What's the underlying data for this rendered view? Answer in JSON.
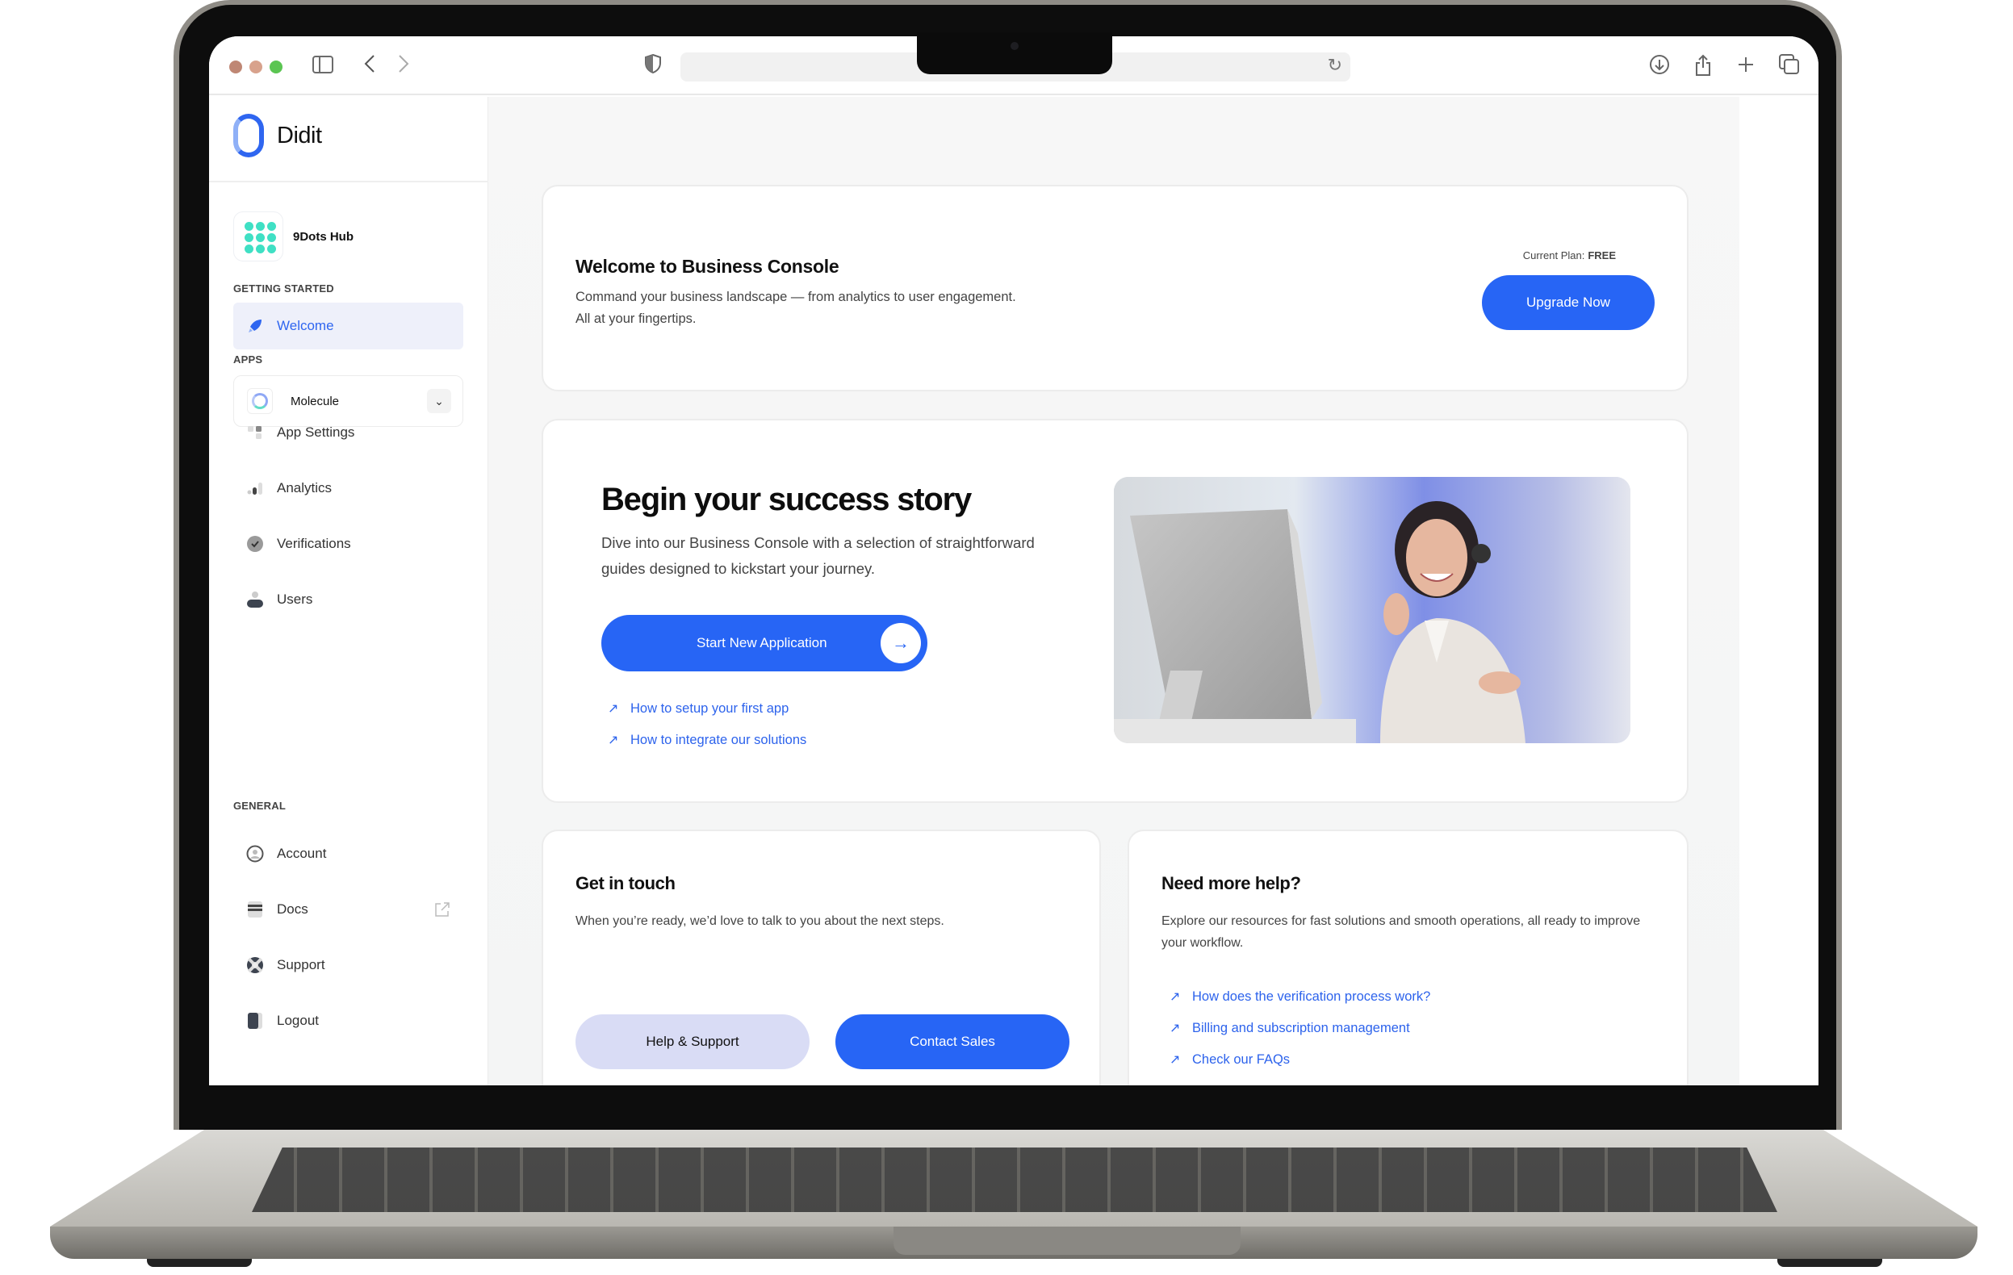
{
  "browser": {
    "traffic_lights": [
      "#bf8774",
      "#d8a28c",
      "#5bc552"
    ],
    "url": ""
  },
  "sidebar": {
    "brand": "Didit",
    "organization": "9Dots Hub",
    "sections": {
      "getting_started": "GETTING STARTED",
      "apps": "APPS",
      "general": "GENERAL"
    },
    "getting_started_items": [
      {
        "label": "Welcome",
        "icon": "rocket-icon",
        "active": true
      }
    ],
    "app_selector": {
      "selected": "Molecule"
    },
    "app_items": [
      {
        "label": "App Settings",
        "icon": "app-settings-icon"
      },
      {
        "label": "Analytics",
        "icon": "analytics-icon"
      },
      {
        "label": "Verifications",
        "icon": "verified-badge-icon"
      },
      {
        "label": "Users",
        "icon": "user-icon"
      }
    ],
    "general_items": [
      {
        "label": "Account",
        "icon": "account-circle-icon"
      },
      {
        "label": "Docs",
        "icon": "docs-icon",
        "external": true
      },
      {
        "label": "Support",
        "icon": "lifebuoy-icon"
      },
      {
        "label": "Logout",
        "icon": "logout-icon"
      }
    ]
  },
  "welcome_card": {
    "title": "Welcome to Business Console",
    "description_line1": "Command your business landscape — from analytics to user engagement.",
    "description_line2": "All at your fingertips.",
    "plan_label": "Current Plan:",
    "plan_value": "FREE",
    "upgrade_label": "Upgrade Now"
  },
  "success_card": {
    "title": "Begin your success story",
    "description": "Dive into our Business Console with a selection of straightforward guides designed to kickstart your journey.",
    "start_button": "Start New Application",
    "links": [
      "How to setup your first app",
      "How to integrate our solutions"
    ],
    "image_alt": "Smiling support agent with headset at a desktop computer"
  },
  "contact_card": {
    "title": "Get in touch",
    "description": "When you’re ready, we’d love to talk to you about the next steps.",
    "help_button": "Help & Support",
    "sales_button": "Contact Sales"
  },
  "help_card": {
    "title": "Need more help?",
    "description": "Explore our resources for fast solutions and smooth operations, all ready to improve your workflow.",
    "links": [
      "How does the verification process work?",
      "Billing and subscription management",
      "Check our FAQs"
    ]
  },
  "colors": {
    "accent": "#2765f5",
    "link": "#2d63ec",
    "active_nav_bg": "#eef0fa",
    "secondary_button": "#d9dcf5",
    "org_logo": "#3fe0c4"
  }
}
